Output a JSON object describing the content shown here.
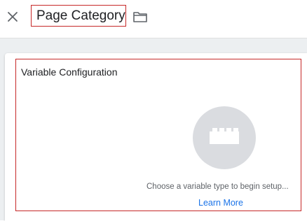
{
  "header": {
    "title": "Page Category",
    "icons": {
      "close": "close-icon",
      "folder": "folder-icon"
    }
  },
  "config": {
    "section_title": "Variable Configuration",
    "empty_state_icon": "lego-block-icon",
    "help_text": "Choose a variable type to begin setup...",
    "learn_more": "Learn More"
  },
  "colors": {
    "accent_link": "#1a73e8",
    "highlight_border": "#c62828",
    "background": "#eceff1",
    "icon_circle": "#dadce0"
  }
}
